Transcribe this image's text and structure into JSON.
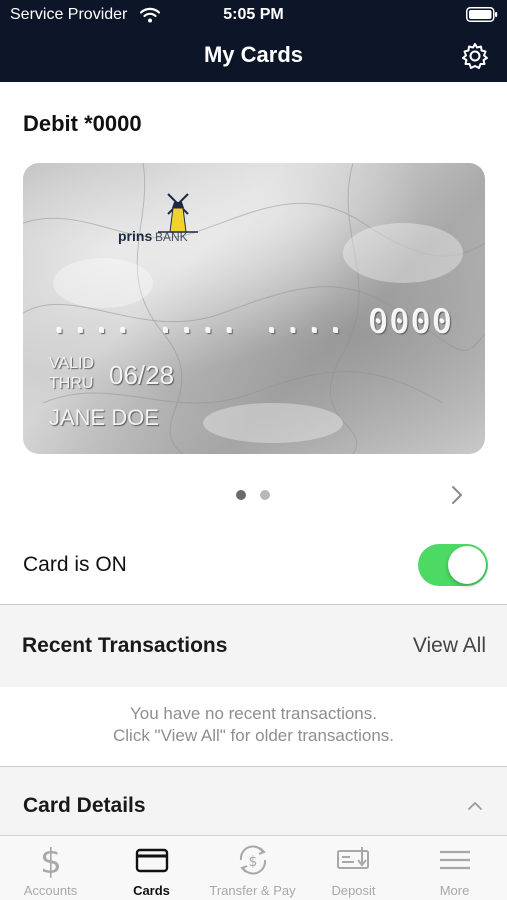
{
  "status_bar": {
    "carrier": "Service Provider",
    "time": "5:05 PM"
  },
  "nav": {
    "title": "My Cards"
  },
  "card": {
    "title": "Debit *0000",
    "bank_logo": "prinsBANK",
    "number": ".... .... .... 0000",
    "valid_label_line1": "VALID",
    "valid_label_line2": "THRU",
    "expiry": "06/28",
    "holder": "JANE DOE",
    "page_dots": {
      "count": 2,
      "active_index": 0
    }
  },
  "toggle": {
    "label": "Card is ON",
    "state": "on",
    "color": "#4cd964"
  },
  "recent": {
    "title": "Recent Transactions",
    "view_all": "View All",
    "empty_line1": "You have no recent transactions.",
    "empty_line2": "Click \"View All\" for older transactions."
  },
  "details": {
    "title": "Card Details"
  },
  "tabbar": {
    "tabs": [
      {
        "label": "Accounts",
        "icon": "dollar-icon",
        "active": false
      },
      {
        "label": "Cards",
        "icon": "card-icon",
        "active": true
      },
      {
        "label": "Transfer & Pay",
        "icon": "transfer-icon",
        "active": false
      },
      {
        "label": "Deposit",
        "icon": "check-deposit-icon",
        "active": false
      },
      {
        "label": "More",
        "icon": "menu-icon",
        "active": false
      }
    ]
  },
  "colors": {
    "header_bg": "#0d1629",
    "accent_green": "#4cd964",
    "muted_text": "#8e8e8e"
  }
}
